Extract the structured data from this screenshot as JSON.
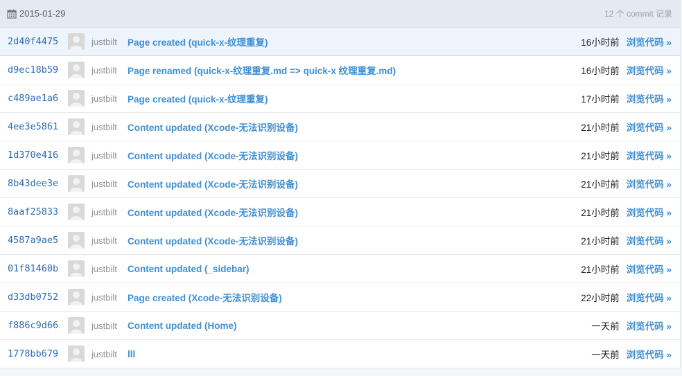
{
  "header": {
    "date": "2015-01-29",
    "commit_count": "12 个 commit 记录"
  },
  "browse_label": "浏览代码 »",
  "commits": [
    {
      "sha": "2d40f4475",
      "author": "justbilt",
      "message": "Page created (quick-x-纹理重复)",
      "time": "16小时前"
    },
    {
      "sha": "d9ec18b59",
      "author": "justbilt",
      "message": "Page renamed (quick-x-纹理重复.md => quick-x 纹理重复.md)",
      "time": "16小时前"
    },
    {
      "sha": "c489ae1a6",
      "author": "justbilt",
      "message": "Page created (quick-x-纹理重复)",
      "time": "17小时前"
    },
    {
      "sha": "4ee3e5861",
      "author": "justbilt",
      "message": "Content updated (Xcode-无法识别设备)",
      "time": "21小时前"
    },
    {
      "sha": "1d370e416",
      "author": "justbilt",
      "message": "Content updated (Xcode-无法识别设备)",
      "time": "21小时前"
    },
    {
      "sha": "8b43dee3e",
      "author": "justbilt",
      "message": "Content updated (Xcode-无法识别设备)",
      "time": "21小时前"
    },
    {
      "sha": "8aaf25833",
      "author": "justbilt",
      "message": "Content updated (Xcode-无法识别设备)",
      "time": "21小时前"
    },
    {
      "sha": "4587a9ae5",
      "author": "justbilt",
      "message": "Content updated (Xcode-无法识别设备)",
      "time": "21小时前"
    },
    {
      "sha": "01f81460b",
      "author": "justbilt",
      "message": "Content updated (_sidebar)",
      "time": "21小时前"
    },
    {
      "sha": "d33db0752",
      "author": "justbilt",
      "message": "Page created (Xcode-无法识别设备)",
      "time": "22小时前"
    },
    {
      "sha": "f886c9d66",
      "author": "justbilt",
      "message": "Content updated (Home)",
      "time": "一天前"
    },
    {
      "sha": "1778bb679",
      "author": "justbilt",
      "message": "lll",
      "time": "一天前"
    }
  ]
}
